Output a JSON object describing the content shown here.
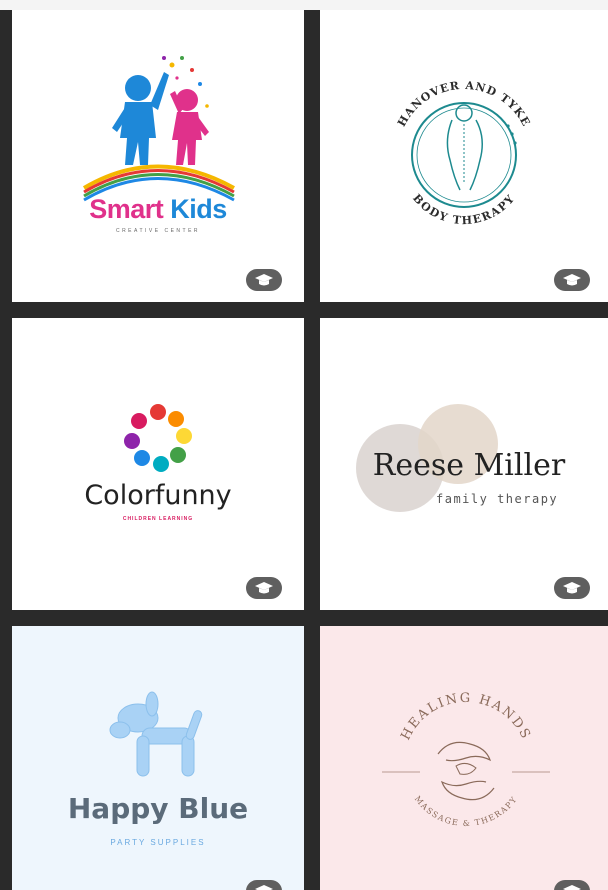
{
  "templates": [
    {
      "id": "smart-kids",
      "brand": "Smart Kids",
      "brand_part1": "Smart",
      "brand_part2": "Kids",
      "tagline": "CREATIVE CENTER",
      "background": "#ffffff",
      "badge_icon": "graduation-cap-icon"
    },
    {
      "id": "hanover-tyke",
      "top_arc": "HANOVER AND TYKE",
      "bottom_arc": "BODY THERAPY",
      "background": "#ffffff",
      "badge_icon": "graduation-cap-icon"
    },
    {
      "id": "colorfunny",
      "brand": "Colorfunny",
      "tagline": "CHILDREN LEARNING",
      "background": "#ffffff",
      "badge_icon": "graduation-cap-icon"
    },
    {
      "id": "reese-miller",
      "brand": "Reese Miller",
      "tagline": "family therapy",
      "background": "#ffffff",
      "badge_icon": "graduation-cap-icon"
    },
    {
      "id": "happy-blue",
      "brand": "Happy Blue",
      "tagline": "PARTY SUPPLIES",
      "background": "#eef6fd",
      "badge_icon": "graduation-cap-icon"
    },
    {
      "id": "healing-hands",
      "top_arc": "HEALING HANDS",
      "bottom_arc": "MASSAGE & THERAPY",
      "background": "#fbe8ea",
      "badge_icon": "graduation-cap-icon"
    }
  ],
  "colors": {
    "gutter": "#2a2a2a",
    "badge": "#5f5f5f",
    "smart_kids_blue": "#1e88d8",
    "smart_kids_pink": "#e0318b",
    "teal": "#1d8a8f",
    "happy_blue_text": "#5b6b7a",
    "healing_brown": "#8a6a5a"
  }
}
